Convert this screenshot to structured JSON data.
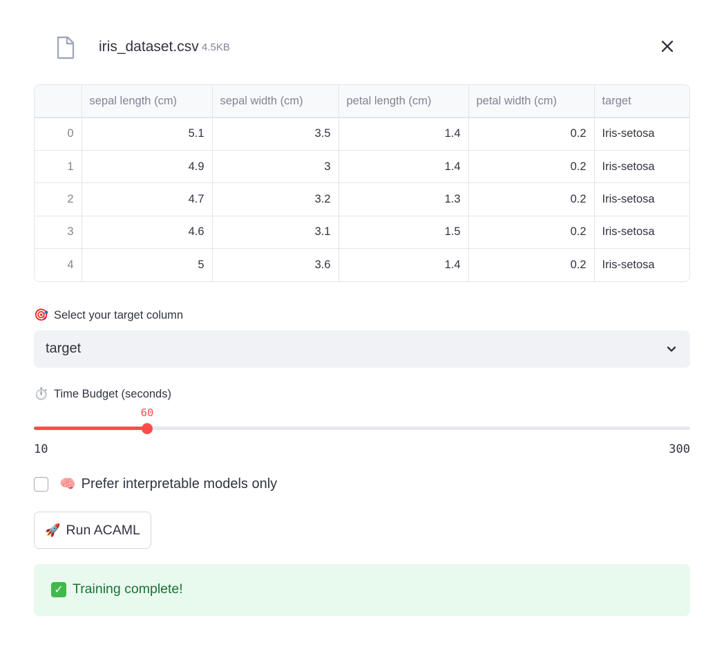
{
  "file": {
    "name": "iris_dataset.csv",
    "size": "4.5KB",
    "icon": "file-icon",
    "close_icon": "close-icon"
  },
  "table": {
    "columns": [
      "",
      "sepal length (cm)",
      "sepal width (cm)",
      "petal length (cm)",
      "petal width (cm)",
      "target"
    ],
    "rows": [
      [
        "0",
        "5.1",
        "3.5",
        "1.4",
        "0.2",
        "Iris-setosa"
      ],
      [
        "1",
        "4.9",
        "3",
        "1.4",
        "0.2",
        "Iris-setosa"
      ],
      [
        "2",
        "4.7",
        "3.2",
        "1.3",
        "0.2",
        "Iris-setosa"
      ],
      [
        "3",
        "4.6",
        "3.1",
        "1.5",
        "0.2",
        "Iris-setosa"
      ],
      [
        "4",
        "5",
        "3.6",
        "1.4",
        "0.2",
        "Iris-setosa"
      ]
    ]
  },
  "target_select": {
    "emoji": "🎯",
    "label": "Select your target column",
    "value": "target"
  },
  "time_budget": {
    "emoji": "⏱️",
    "label": "Time Budget (seconds)",
    "value": "60",
    "min": "10",
    "max": "300",
    "fraction": 0.1724
  },
  "interpretable": {
    "emoji": "🧠",
    "label": "Prefer interpretable models only",
    "checked": false
  },
  "run_button": {
    "emoji": "🚀",
    "label": "Run ACAML"
  },
  "success": {
    "icon": "check-icon",
    "text": "Training complete!"
  },
  "colors": {
    "accent": "#ff4b4b",
    "success_bg": "#e8f9ee",
    "success_text": "#177233",
    "select_bg": "#f0f2f6",
    "muted_text": "#808495"
  }
}
